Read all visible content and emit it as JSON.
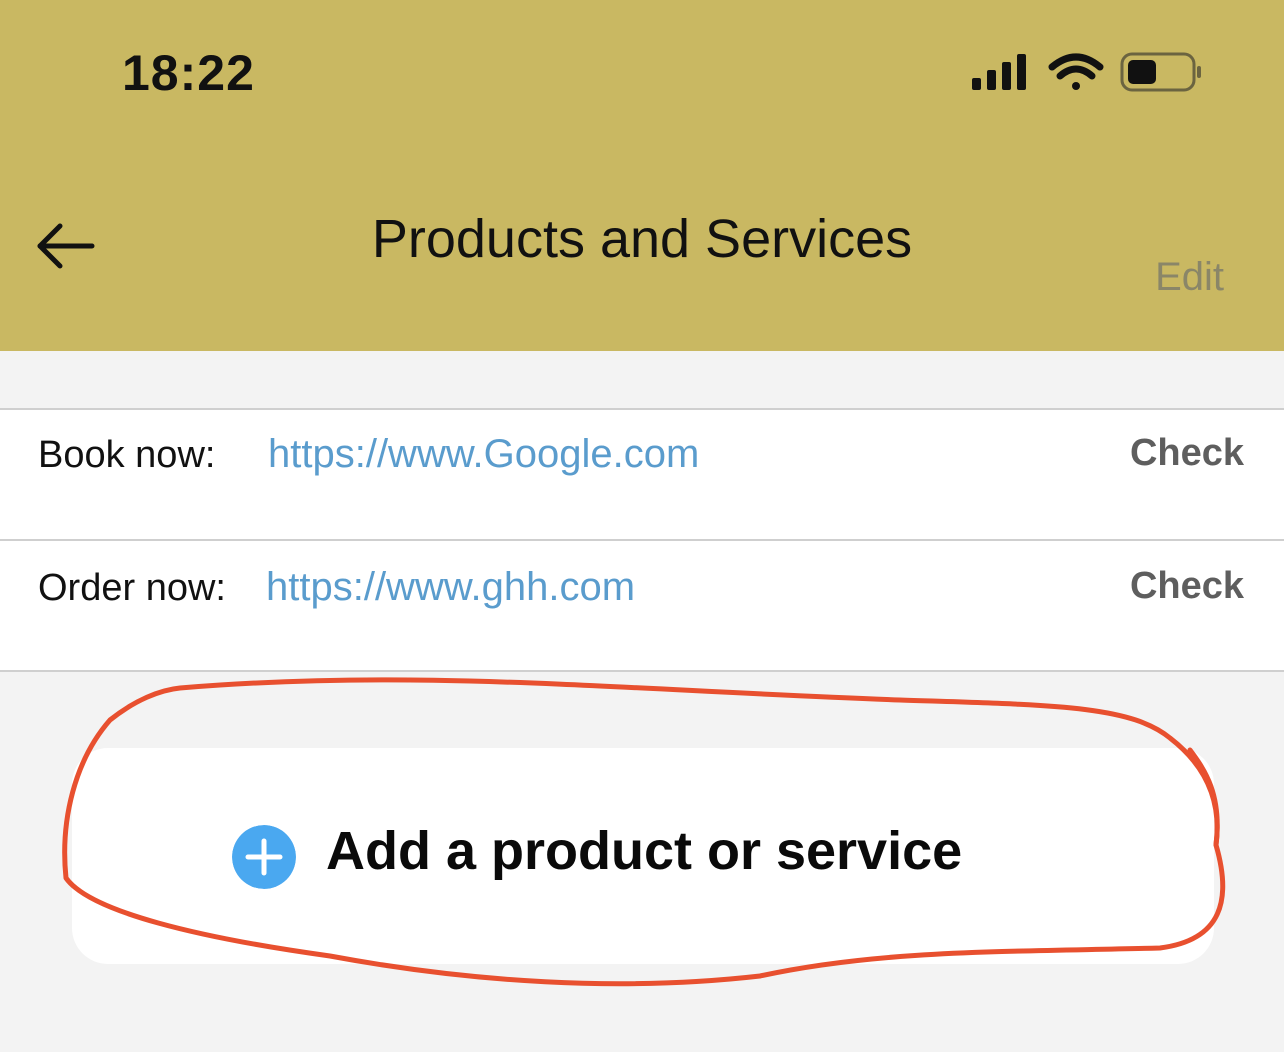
{
  "colors": {
    "header_bg": "#c9b862",
    "link": "#5a9ccd",
    "add_icon": "#4aa8f0",
    "annotation": "#e8502f"
  },
  "status_bar": {
    "time": "18:22",
    "icons": [
      "cellular-signal-icon",
      "wifi-icon",
      "battery-icon"
    ]
  },
  "nav": {
    "back_icon": "arrow-left-icon",
    "title": "Products and Services",
    "edit_label": "Edit"
  },
  "items": [
    {
      "label": "Book now:",
      "url": "https://www.Google.com",
      "action": "Check"
    },
    {
      "label": "Order now:",
      "url": "https://www.ghh.com",
      "action": "Check"
    }
  ],
  "add_button": {
    "icon": "plus-circle-icon",
    "label": "Add a product or service"
  }
}
